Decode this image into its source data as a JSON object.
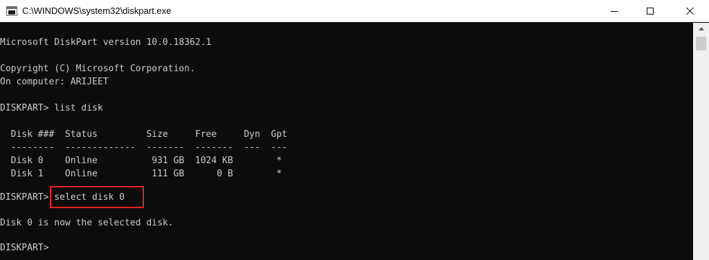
{
  "window": {
    "title": "C:\\WINDOWS\\system32\\diskpart.exe"
  },
  "console": {
    "lines": [
      "Microsoft DiskPart version 10.0.18362.1",
      "",
      "Copyright (C) Microsoft Corporation.",
      "On computer: ARIJEET",
      "",
      "DISKPART> list disk",
      "",
      "  Disk ###  Status         Size     Free     Dyn  Gpt",
      "  --------  -------------  -------  -------  ---  ---",
      "  Disk 0    Online          931 GB  1024 KB        *",
      "  Disk 1    Online          111 GB      0 B        *",
      "",
      "DISKPART> select disk 0",
      "",
      "Disk 0 is now the selected disk.",
      "",
      "DISKPART> "
    ]
  },
  "colors": {
    "background": "#0c0c0c",
    "text": "#cccccc",
    "highlight": "#e02424"
  },
  "icons": {
    "app": "console-icon",
    "minimize": "minimize-icon",
    "maximize": "maximize-icon",
    "close": "close-icon"
  }
}
